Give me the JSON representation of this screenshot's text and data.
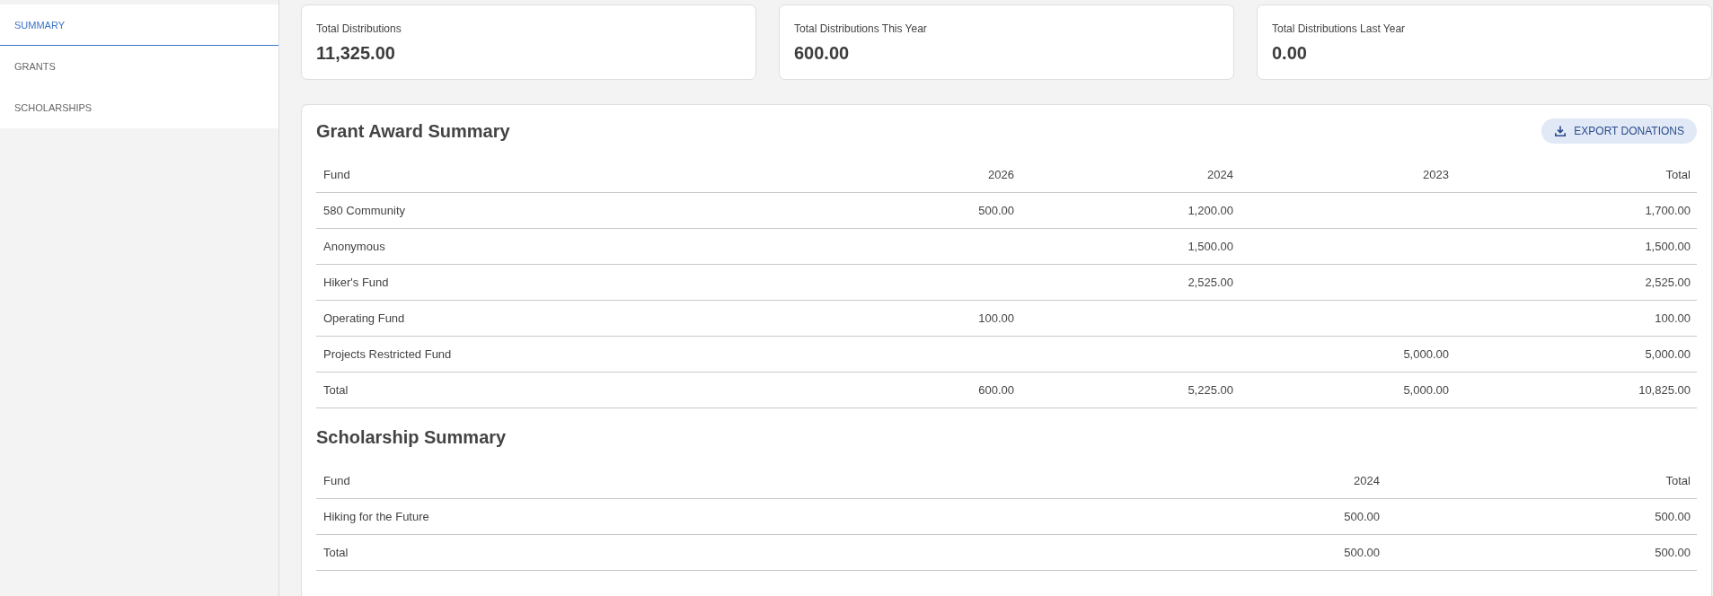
{
  "sidebar": {
    "items": [
      {
        "label": "SUMMARY",
        "selected": true
      },
      {
        "label": "GRANTS",
        "selected": false
      },
      {
        "label": "SCHOLARSHIPS",
        "selected": false
      }
    ]
  },
  "stat_cards": [
    {
      "label": "Total Distributions",
      "value": "11,325.00"
    },
    {
      "label": "Total Distributions This Year",
      "value": "600.00"
    },
    {
      "label": "Total Distributions Last Year",
      "value": "0.00"
    }
  ],
  "sections": [
    {
      "title": "Grant Award Summary",
      "export_button": {
        "label": "EXPORT DONATIONS"
      },
      "table": {
        "columns": [
          "Fund",
          "2026",
          "2024",
          "2023",
          "Total"
        ],
        "rows": [
          [
            "580 Community",
            "500.00",
            "1,200.00",
            null,
            "1,700.00"
          ],
          [
            "Anonymous",
            null,
            "1,500.00",
            null,
            "1,500.00"
          ],
          [
            "Hiker's Fund",
            null,
            "2,525.00",
            null,
            "2,525.00"
          ],
          [
            "Operating Fund",
            "100.00",
            null,
            null,
            "100.00"
          ],
          [
            "Projects Restricted Fund",
            null,
            null,
            "5,000.00",
            "5,000.00"
          ],
          [
            "Total",
            "600.00",
            "5,225.00",
            "5,000.00",
            "10,825.00"
          ]
        ]
      }
    },
    {
      "title": "Scholarship Summary",
      "table": {
        "columns": [
          "Fund",
          "2024",
          "Total"
        ],
        "rows": [
          [
            "Hiking for the Future",
            "500.00",
            "500.00"
          ],
          [
            "Total",
            "500.00",
            "500.00"
          ]
        ]
      }
    }
  ]
}
